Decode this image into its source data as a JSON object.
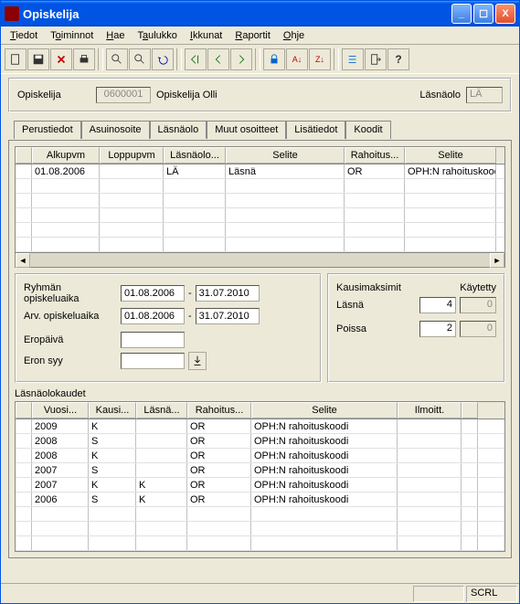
{
  "window_title": "Opiskelija",
  "menu": [
    "Tiedot",
    "Toiminnot",
    "Hae",
    "Taulukko",
    "Ikkunat",
    "Raportit",
    "Ohje"
  ],
  "header": {
    "label_left": "Opiskelija",
    "id": "0600001",
    "name": "Opiskelija Olli",
    "label_right": "Läsnäolo",
    "code": "LÄ"
  },
  "tabs": [
    "Perustiedot",
    "Asuinosoite",
    "Läsnäolo",
    "Muut osoitteet",
    "Lisätiedot",
    "Koodit"
  ],
  "active_tab_index": 2,
  "grid1": {
    "headers": [
      "",
      "Alkupvm",
      "Loppupvm",
      "Läsnäolo...",
      "Selite",
      "Rahoitus...",
      "Selite"
    ],
    "rows": [
      [
        "",
        "01.08.2006",
        "",
        "LÄ",
        "Läsnä",
        "OR",
        "OPH:N rahoituskoodi"
      ]
    ]
  },
  "form": {
    "ryhma_label": "Ryhmän opiskeluaika",
    "ryhma_from": "01.08.2006",
    "ryhma_to": "31.07.2010",
    "arv_label": "Arv. opiskeluaika",
    "arv_from": "01.08.2006",
    "arv_to": "31.07.2010",
    "eropv_label": "Eropäivä",
    "erosyy_label": "Eron syy",
    "sep": "-"
  },
  "kmax": {
    "title": "Kausimaksimit",
    "kaytetty": "Käytetty",
    "lasna_label": "Läsnä",
    "lasna_max": "4",
    "lasna_used": "0",
    "poissa_label": "Poissa",
    "poissa_max": "2",
    "poissa_used": "0"
  },
  "section2_label": "Läsnäolokaudet",
  "grid2": {
    "headers": [
      "",
      "Vuosi...",
      "Kausi...",
      "Läsnä...",
      "Rahoitus...",
      "Selite",
      "Ilmoitt.",
      ""
    ],
    "rows": [
      [
        "",
        "2009",
        "K",
        "",
        "OR",
        "OPH:N rahoituskoodi",
        "",
        ""
      ],
      [
        "",
        "2008",
        "S",
        "",
        "OR",
        "OPH:N rahoituskoodi",
        "",
        ""
      ],
      [
        "",
        "2008",
        "K",
        "",
        "OR",
        "OPH:N rahoituskoodi",
        "",
        ""
      ],
      [
        "",
        "2007",
        "S",
        "",
        "OR",
        "OPH:N rahoituskoodi",
        "",
        ""
      ],
      [
        "",
        "2007",
        "K",
        "K",
        "OR",
        "OPH:N rahoituskoodi",
        "",
        ""
      ],
      [
        "",
        "2006",
        "S",
        "K",
        "OR",
        "OPH:N rahoituskoodi",
        "",
        ""
      ]
    ]
  },
  "status": {
    "scrl": "SCRL"
  },
  "chart_data": null
}
